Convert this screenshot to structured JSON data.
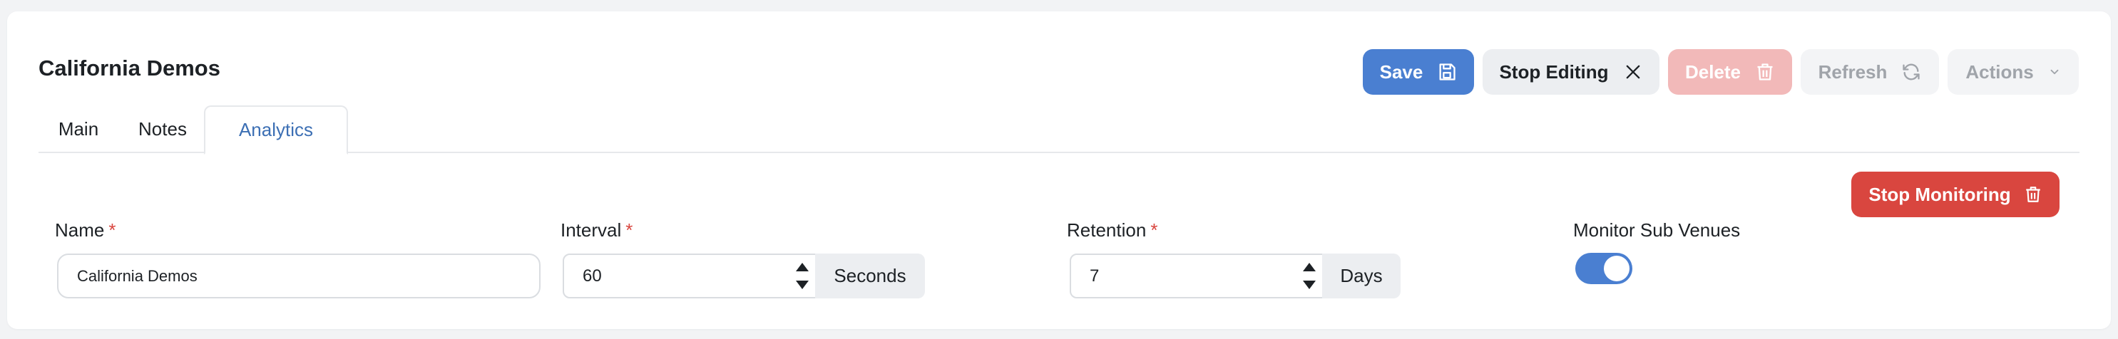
{
  "header": {
    "title": "California Demos"
  },
  "toolbar": {
    "save_label": "Save",
    "stop_editing_label": "Stop Editing",
    "delete_label": "Delete",
    "refresh_label": "Refresh",
    "actions_label": "Actions"
  },
  "tabs": [
    {
      "label": "Main",
      "active": false
    },
    {
      "label": "Notes",
      "active": false
    },
    {
      "label": "Analytics",
      "active": true
    }
  ],
  "analytics": {
    "stop_monitoring_label": "Stop Monitoring",
    "name": {
      "label": "Name",
      "required_mark": "*",
      "value": "California Demos"
    },
    "interval": {
      "label": "Interval",
      "required_mark": "*",
      "value": "60",
      "unit": "Seconds"
    },
    "retention": {
      "label": "Retention",
      "required_mark": "*",
      "value": "7",
      "unit": "Days"
    },
    "monitor_sub_venues": {
      "label": "Monitor Sub Venues",
      "enabled": true
    }
  },
  "colors": {
    "primary": "#4a7fd1",
    "danger": "#d9463f",
    "danger_disabled": "#f2b9b9",
    "tab_active": "#3c6fb4"
  }
}
